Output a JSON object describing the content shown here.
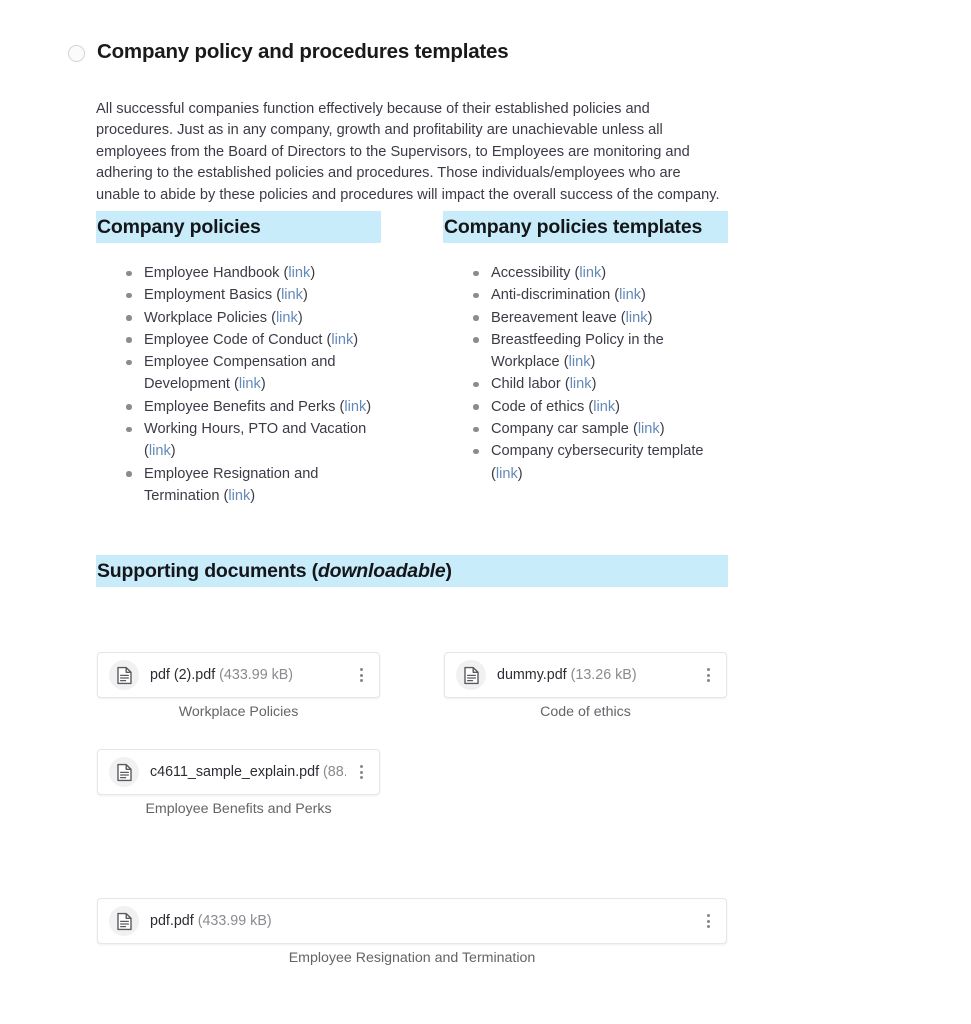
{
  "header": {
    "title": "Company policy and procedures templates",
    "radio_icon": "circle-outline-icon"
  },
  "intro": {
    "paragraph": "All successful companies function effectively because of their established policies and procedures. Just as in any company, growth and profitability are unachievable unless all employees from the Board of Directors to the Supervisors, to Employees are monitoring and adhering to the established policies and procedures. Those individuals/employees who are unable to abide by these policies and procedures will impact the overall success of the company."
  },
  "sections": {
    "company_policies": {
      "heading": "Company policies",
      "items": [
        {
          "text": "Employee Handbook",
          "link": "link"
        },
        {
          "text": "Employment Basics",
          "link": "link"
        },
        {
          "text": "Workplace Policies",
          "link": "link"
        },
        {
          "text": "Employee Code of Conduct",
          "link": "link"
        },
        {
          "text": "Employee Compensation and Development",
          "link": "link"
        },
        {
          "text": "Employee Benefits and Perks",
          "link": "link"
        },
        {
          "text": "Working Hours, PTO and Vacation",
          "link": "link"
        },
        {
          "text": "Employee Resignation and Termination",
          "link": "link"
        }
      ]
    },
    "company_policies_templates": {
      "heading": "Company policies templates",
      "items": [
        {
          "text": "Accessibility",
          "link": "link"
        },
        {
          "text": "Anti-discrimination",
          "link": "link"
        },
        {
          "text": "Bereavement leave",
          "link": "link"
        },
        {
          "text": "Breastfeeding Policy in the Workplace",
          "link": "link"
        },
        {
          "text": "Child labor",
          "link": "link"
        },
        {
          "text": "Code of ethics",
          "link": "link"
        },
        {
          "text": "Company car sample",
          "link": "link"
        },
        {
          "text": "Company cybersecurity template",
          "link": "link"
        }
      ]
    },
    "supporting_documents": {
      "heading_prefix": "Supporting documents (",
      "heading_emphasis": "downloadable",
      "heading_suffix": ")",
      "files": [
        {
          "icon": "document-icon",
          "filename": "pdf (2).pdf",
          "size": "(433.99 kB)",
          "caption": "Workplace Policies",
          "menu_icon": "kebab-menu-icon"
        },
        {
          "icon": "document-icon",
          "filename": "dummy.pdf",
          "size": "(13.26 kB)",
          "caption": "Code of ethics",
          "menu_icon": "kebab-menu-icon"
        },
        {
          "icon": "document-icon",
          "filename": "c4611_sample_explain.pdf",
          "size": "(88....",
          "caption": "Employee Benefits and Perks",
          "menu_icon": "kebab-menu-icon"
        },
        {
          "icon": "document-icon",
          "filename": "pdf.pdf",
          "size": "(433.99 kB)",
          "caption": "Employee Resignation and Termination",
          "menu_icon": "kebab-menu-icon"
        }
      ]
    }
  },
  "colors": {
    "highlight": "#c9ecfb",
    "link": "#6389b8",
    "body_text": "#3b3b46",
    "title_text": "#1a1a1a",
    "caption_text": "#646469",
    "bullet": "#8c8c8c",
    "card_border": "#e6e6e6"
  }
}
